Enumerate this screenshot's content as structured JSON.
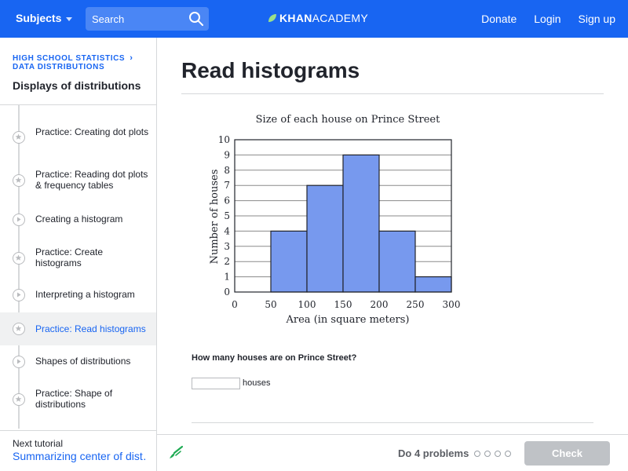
{
  "nav": {
    "subjects_label": "Subjects",
    "search_placeholder": "Search",
    "logo_khan": "KHAN",
    "logo_academy": "ACADEMY",
    "donate": "Donate",
    "login": "Login",
    "signup": "Sign up"
  },
  "sidebar": {
    "crumb_course": "HIGH SCHOOL STATISTICS",
    "crumb_unit": "DATA DISTRIBUTIONS",
    "title": "Displays of distributions",
    "items": [
      {
        "label": "Practice: Creating dot plots",
        "type": "practice",
        "active": false
      },
      {
        "label": "Practice: Reading dot plots & frequency tables",
        "type": "practice",
        "active": false
      },
      {
        "label": "Creating a histogram",
        "type": "video",
        "active": false
      },
      {
        "label": "Practice: Create histograms",
        "type": "practice",
        "active": false
      },
      {
        "label": "Interpreting a histogram",
        "type": "video",
        "active": false
      },
      {
        "label": "Practice: Read histograms",
        "type": "practice",
        "active": true
      },
      {
        "label": "Shapes of distributions",
        "type": "video",
        "active": false
      },
      {
        "label": "Practice: Shape of distributions",
        "type": "practice",
        "active": false
      }
    ],
    "next_label": "Next tutorial",
    "next_link": "Summarizing center of dist…"
  },
  "main": {
    "title": "Read histograms",
    "question": "How many houses are on Prince Street?",
    "answer_value": "",
    "unit": "houses"
  },
  "bottom": {
    "do_problems": "Do 4 problems",
    "check_label": "Check",
    "dots_count": 4
  },
  "chart_data": {
    "type": "bar",
    "title": "Size of each house on Prince Street",
    "xlabel": "Area (in square meters)",
    "ylabel": "Number of houses",
    "bins": [
      [
        0,
        50
      ],
      [
        50,
        100
      ],
      [
        100,
        150
      ],
      [
        150,
        200
      ],
      [
        200,
        250
      ],
      [
        250,
        300
      ]
    ],
    "values": [
      0,
      4,
      7,
      9,
      4,
      1
    ],
    "xlim": [
      0,
      300
    ],
    "ylim": [
      0,
      10
    ],
    "xticks": [
      0,
      50,
      100,
      150,
      200,
      250,
      300
    ],
    "yticks": [
      0,
      1,
      2,
      3,
      4,
      5,
      6,
      7,
      8,
      9,
      10
    ],
    "grid": true,
    "bar_color": "#7799ee"
  },
  "colors": {
    "brand": "#1865f2",
    "check_disabled": "#bfc2c6",
    "scratch_green": "#1fab54"
  }
}
